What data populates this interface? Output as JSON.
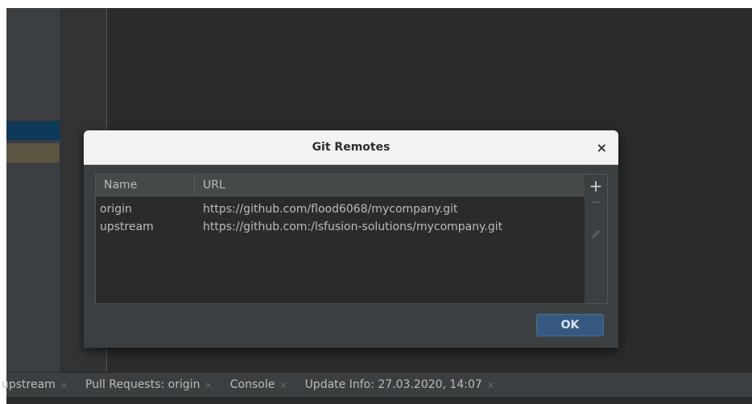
{
  "dialog": {
    "title": "Git Remotes",
    "close_glyph": "×",
    "table": {
      "headers": {
        "name": "Name",
        "url": "URL"
      },
      "rows": [
        {
          "name": "origin",
          "url": "https://github.com/flood6068/mycompany.git"
        },
        {
          "name": "upstream",
          "url": "https://github.com:/lsfusion-solutions/mycompany.git"
        }
      ]
    },
    "tools": {
      "add_glyph": "+",
      "remove_glyph": "−",
      "icon_names": [
        "plus-icon",
        "minus-icon",
        "pencil-icon"
      ]
    },
    "ok_label": "OK"
  },
  "bottom_bar": {
    "tabs": [
      {
        "label": "upstream",
        "close": "×"
      },
      {
        "label": "Pull Requests: origin",
        "close": "×"
      },
      {
        "label": "Console",
        "close": "×"
      },
      {
        "label": "Update Info: 27.03.2020, 14:07",
        "close": "×"
      }
    ]
  },
  "colors": {
    "editor_bg": "#2b2b2b",
    "panel_bg": "#3c3f41",
    "accent_button": "#365880",
    "selection_blue": "#0d3a58",
    "selection_olive": "#5b5542"
  }
}
